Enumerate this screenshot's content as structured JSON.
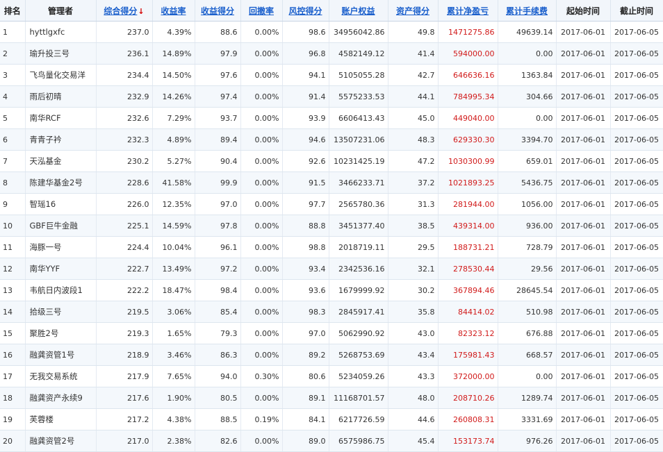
{
  "headers": {
    "rank": "排名",
    "manager": "管理者",
    "total_score": "综合得分",
    "sort_arrow": "↓",
    "return_rate": "收益率",
    "return_score": "收益得分",
    "drawdown": "回撤率",
    "risk_score": "风控得分",
    "equity": "账户权益",
    "asset_score": "资产得分",
    "cum_pnl": "累计净盈亏",
    "cum_fee": "累计手续费",
    "start_time": "起始时间",
    "end_time": "截止时间"
  },
  "accent_colors": {
    "link": "#1a5fcc",
    "profit": "#d11a1a",
    "header_bg": "#f2f6fb"
  },
  "rows": [
    {
      "rank": "1",
      "manager": "hyttlgxfc",
      "total_score": "237.0",
      "return_rate": "4.39%",
      "return_score": "88.6",
      "drawdown": "0.00%",
      "risk_score": "98.6",
      "equity": "34956042.86",
      "asset_score": "49.8",
      "cum_pnl": "1471275.86",
      "cum_fee": "49639.14",
      "start": "2017-06-01",
      "end": "2017-06-05"
    },
    {
      "rank": "2",
      "manager": "瑜升投三号",
      "total_score": "236.1",
      "return_rate": "14.89%",
      "return_score": "97.9",
      "drawdown": "0.00%",
      "risk_score": "96.8",
      "equity": "4582149.12",
      "asset_score": "41.4",
      "cum_pnl": "594000.00",
      "cum_fee": "0.00",
      "start": "2017-06-01",
      "end": "2017-06-05"
    },
    {
      "rank": "3",
      "manager": "飞鸟量化交易洋",
      "total_score": "234.4",
      "return_rate": "14.50%",
      "return_score": "97.6",
      "drawdown": "0.00%",
      "risk_score": "94.1",
      "equity": "5105055.28",
      "asset_score": "42.7",
      "cum_pnl": "646636.16",
      "cum_fee": "1363.84",
      "start": "2017-06-01",
      "end": "2017-06-05"
    },
    {
      "rank": "4",
      "manager": "雨后初晴",
      "total_score": "232.9",
      "return_rate": "14.26%",
      "return_score": "97.4",
      "drawdown": "0.00%",
      "risk_score": "91.4",
      "equity": "5575233.53",
      "asset_score": "44.1",
      "cum_pnl": "784995.34",
      "cum_fee": "304.66",
      "start": "2017-06-01",
      "end": "2017-06-05"
    },
    {
      "rank": "5",
      "manager": "南华RCF",
      "total_score": "232.6",
      "return_rate": "7.29%",
      "return_score": "93.7",
      "drawdown": "0.00%",
      "risk_score": "93.9",
      "equity": "6606413.43",
      "asset_score": "45.0",
      "cum_pnl": "449040.00",
      "cum_fee": "0.00",
      "start": "2017-06-01",
      "end": "2017-06-05"
    },
    {
      "rank": "6",
      "manager": "青青子衿",
      "total_score": "232.3",
      "return_rate": "4.89%",
      "return_score": "89.4",
      "drawdown": "0.00%",
      "risk_score": "94.6",
      "equity": "13507231.06",
      "asset_score": "48.3",
      "cum_pnl": "629330.30",
      "cum_fee": "3394.70",
      "start": "2017-06-01",
      "end": "2017-06-05"
    },
    {
      "rank": "7",
      "manager": "天泓基金",
      "total_score": "230.2",
      "return_rate": "5.27%",
      "return_score": "90.4",
      "drawdown": "0.00%",
      "risk_score": "92.6",
      "equity": "10231425.19",
      "asset_score": "47.2",
      "cum_pnl": "1030300.99",
      "cum_fee": "659.01",
      "start": "2017-06-01",
      "end": "2017-06-05"
    },
    {
      "rank": "8",
      "manager": "陈建华基金2号",
      "total_score": "228.6",
      "return_rate": "41.58%",
      "return_score": "99.9",
      "drawdown": "0.00%",
      "risk_score": "91.5",
      "equity": "3466233.71",
      "asset_score": "37.2",
      "cum_pnl": "1021893.25",
      "cum_fee": "5436.75",
      "start": "2017-06-01",
      "end": "2017-06-05"
    },
    {
      "rank": "9",
      "manager": "智瑶16",
      "total_score": "226.0",
      "return_rate": "12.35%",
      "return_score": "97.0",
      "drawdown": "0.00%",
      "risk_score": "97.7",
      "equity": "2565780.36",
      "asset_score": "31.3",
      "cum_pnl": "281944.00",
      "cum_fee": "1056.00",
      "start": "2017-06-01",
      "end": "2017-06-05"
    },
    {
      "rank": "10",
      "manager": "GBF巨牛金融",
      "total_score": "225.1",
      "return_rate": "14.59%",
      "return_score": "97.8",
      "drawdown": "0.00%",
      "risk_score": "88.8",
      "equity": "3451377.40",
      "asset_score": "38.5",
      "cum_pnl": "439314.00",
      "cum_fee": "936.00",
      "start": "2017-06-01",
      "end": "2017-06-05"
    },
    {
      "rank": "11",
      "manager": "海豚一号",
      "total_score": "224.4",
      "return_rate": "10.04%",
      "return_score": "96.1",
      "drawdown": "0.00%",
      "risk_score": "98.8",
      "equity": "2018719.11",
      "asset_score": "29.5",
      "cum_pnl": "188731.21",
      "cum_fee": "728.79",
      "start": "2017-06-01",
      "end": "2017-06-05"
    },
    {
      "rank": "12",
      "manager": "南华YYF",
      "total_score": "222.7",
      "return_rate": "13.49%",
      "return_score": "97.2",
      "drawdown": "0.00%",
      "risk_score": "93.4",
      "equity": "2342536.16",
      "asset_score": "32.1",
      "cum_pnl": "278530.44",
      "cum_fee": "29.56",
      "start": "2017-06-01",
      "end": "2017-06-05"
    },
    {
      "rank": "13",
      "manager": "韦航日内波段1",
      "total_score": "222.2",
      "return_rate": "18.47%",
      "return_score": "98.4",
      "drawdown": "0.00%",
      "risk_score": "93.6",
      "equity": "1679999.92",
      "asset_score": "30.2",
      "cum_pnl": "367894.46",
      "cum_fee": "28645.54",
      "start": "2017-06-01",
      "end": "2017-06-05"
    },
    {
      "rank": "14",
      "manager": "拾级三号",
      "total_score": "219.5",
      "return_rate": "3.06%",
      "return_score": "85.4",
      "drawdown": "0.00%",
      "risk_score": "98.3",
      "equity": "2845917.41",
      "asset_score": "35.8",
      "cum_pnl": "84414.02",
      "cum_fee": "510.98",
      "start": "2017-06-01",
      "end": "2017-06-05"
    },
    {
      "rank": "15",
      "manager": "聚胜2号",
      "total_score": "219.3",
      "return_rate": "1.65%",
      "return_score": "79.3",
      "drawdown": "0.00%",
      "risk_score": "97.0",
      "equity": "5062990.92",
      "asset_score": "43.0",
      "cum_pnl": "82323.12",
      "cum_fee": "676.88",
      "start": "2017-06-01",
      "end": "2017-06-05"
    },
    {
      "rank": "16",
      "manager": "融龚资管1号",
      "total_score": "218.9",
      "return_rate": "3.46%",
      "return_score": "86.3",
      "drawdown": "0.00%",
      "risk_score": "89.2",
      "equity": "5268753.69",
      "asset_score": "43.4",
      "cum_pnl": "175981.43",
      "cum_fee": "668.57",
      "start": "2017-06-01",
      "end": "2017-06-05"
    },
    {
      "rank": "17",
      "manager": "无我交易系统",
      "total_score": "217.9",
      "return_rate": "7.65%",
      "return_score": "94.0",
      "drawdown": "0.30%",
      "risk_score": "80.6",
      "equity": "5234059.26",
      "asset_score": "43.3",
      "cum_pnl": "372000.00",
      "cum_fee": "0.00",
      "start": "2017-06-01",
      "end": "2017-06-05"
    },
    {
      "rank": "18",
      "manager": "融龚资产永续9",
      "total_score": "217.6",
      "return_rate": "1.90%",
      "return_score": "80.5",
      "drawdown": "0.00%",
      "risk_score": "89.1",
      "equity": "11168701.57",
      "asset_score": "48.0",
      "cum_pnl": "208710.26",
      "cum_fee": "1289.74",
      "start": "2017-06-01",
      "end": "2017-06-05"
    },
    {
      "rank": "19",
      "manager": "芙蓉楼",
      "total_score": "217.2",
      "return_rate": "4.38%",
      "return_score": "88.5",
      "drawdown": "0.19%",
      "risk_score": "84.1",
      "equity": "6217726.59",
      "asset_score": "44.6",
      "cum_pnl": "260808.31",
      "cum_fee": "3331.69",
      "start": "2017-06-01",
      "end": "2017-06-05"
    },
    {
      "rank": "20",
      "manager": "融龚资管2号",
      "total_score": "217.0",
      "return_rate": "2.38%",
      "return_score": "82.6",
      "drawdown": "0.00%",
      "risk_score": "89.0",
      "equity": "6575986.75",
      "asset_score": "45.4",
      "cum_pnl": "153173.74",
      "cum_fee": "976.26",
      "start": "2017-06-01",
      "end": "2017-06-05"
    }
  ]
}
